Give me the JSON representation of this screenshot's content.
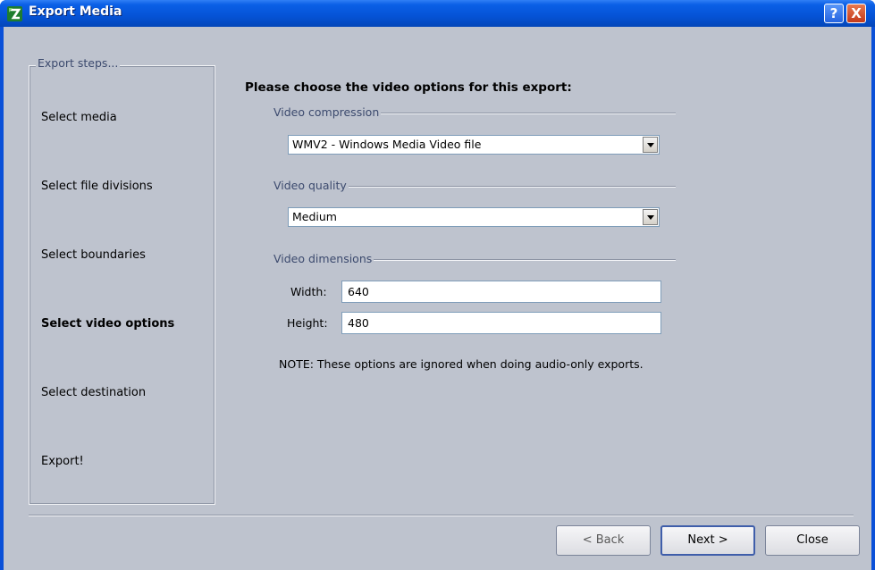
{
  "window": {
    "title": "Export Media"
  },
  "titlebar_buttons": {
    "help": "?",
    "close": "X"
  },
  "steps": {
    "legend": "Export steps...",
    "items": [
      {
        "label": "Select media",
        "active": false
      },
      {
        "label": "Select file divisions",
        "active": false
      },
      {
        "label": "Select boundaries",
        "active": false
      },
      {
        "label": "Select video options",
        "active": true
      },
      {
        "label": "Select destination",
        "active": false
      },
      {
        "label": "Export!",
        "active": false
      }
    ]
  },
  "main": {
    "heading": "Please choose the video options for this export:",
    "compression": {
      "label": "Video compression",
      "value": "WMV2 - Windows Media Video file"
    },
    "quality": {
      "label": "Video quality",
      "value": "Medium"
    },
    "dimensions": {
      "label": "Video dimensions",
      "width_label": "Width:",
      "width_value": "640",
      "height_label": "Height:",
      "height_value": "480"
    },
    "note": "NOTE: These options are ignored when doing audio-only exports."
  },
  "buttons": {
    "back": "< Back",
    "next": "Next >",
    "close": "Close"
  },
  "colors": {
    "titlebar": "#0553d6",
    "dialog_bg": "#bec3ce",
    "group_label": "#3c4a6e"
  }
}
